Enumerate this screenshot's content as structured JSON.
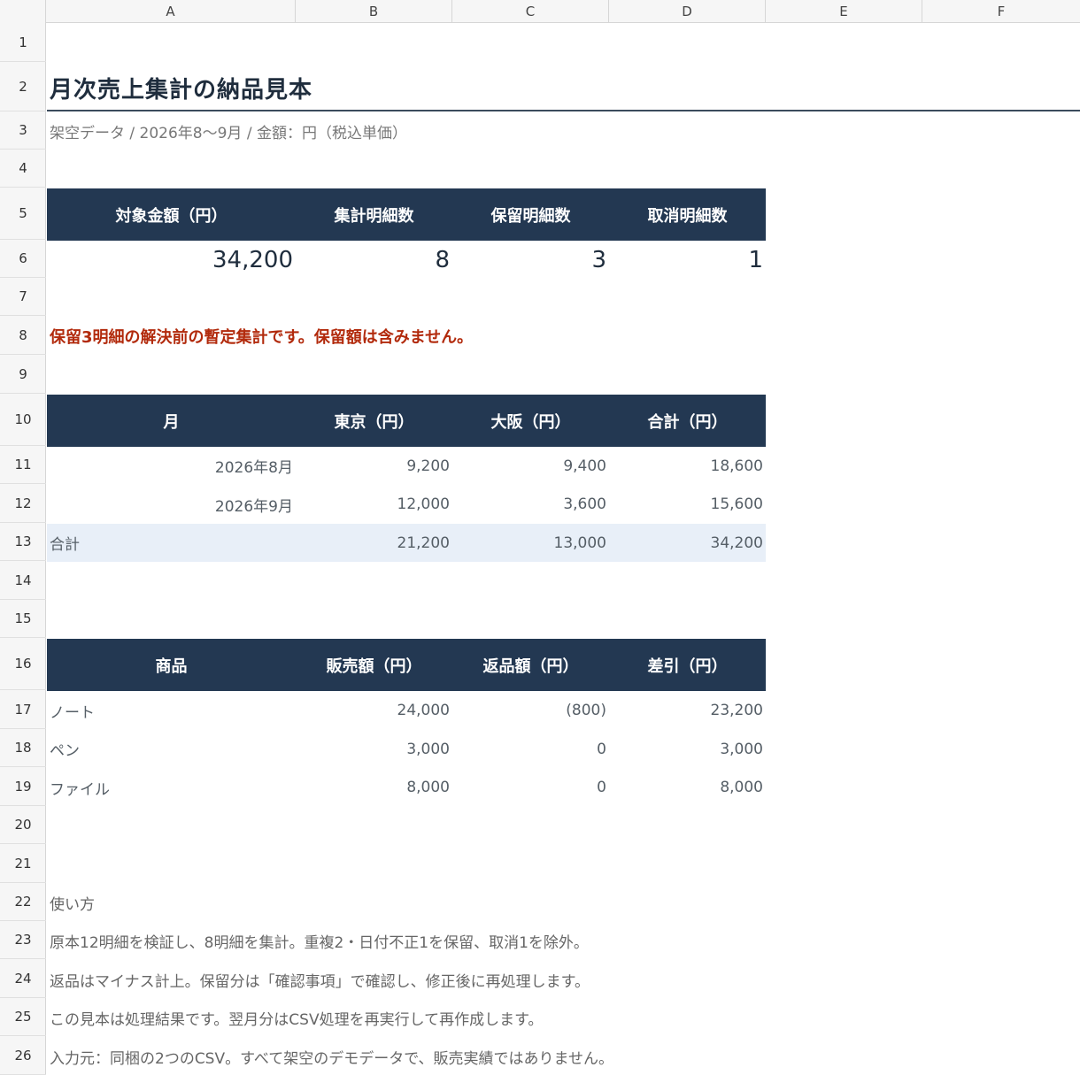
{
  "columns": [
    "A",
    "B",
    "C",
    "D",
    "E",
    "F"
  ],
  "rows": [
    "1",
    "2",
    "3",
    "4",
    "5",
    "6",
    "7",
    "8",
    "9",
    "10",
    "11",
    "12",
    "13",
    "14",
    "15",
    "16",
    "17",
    "18",
    "19",
    "20",
    "21",
    "22",
    "23",
    "24",
    "25",
    "26"
  ],
  "title": "月次売上集計の納品見本",
  "subtitle": "架空データ / 2026年8〜9月 / 金額：円（税込単価）",
  "kpi": {
    "headers": [
      "対象金額（円）",
      "集計明細数",
      "保留明細数",
      "取消明細数"
    ],
    "values": [
      "34,200",
      "8",
      "3",
      "1"
    ]
  },
  "warning": "保留3明細の解決前の暫定集計です。保留額は含みません。",
  "monthly": {
    "headers": [
      "月",
      "東京（円）",
      "大阪（円）",
      "合計（円）"
    ],
    "rows": [
      [
        "2026年8月",
        "9,200",
        "9,400",
        "18,600"
      ],
      [
        "2026年9月",
        "12,000",
        "3,600",
        "15,600"
      ]
    ],
    "total": [
      "合計",
      "21,200",
      "13,000",
      "34,200"
    ]
  },
  "products": {
    "headers": [
      "商品",
      "販売額（円）",
      "返品額（円）",
      "差引（円）"
    ],
    "rows": [
      [
        "ノート",
        "24,000",
        "(800)",
        "23,200"
      ],
      [
        "ペン",
        "3,000",
        "0",
        "3,000"
      ],
      [
        "ファイル",
        "8,000",
        "0",
        "8,000"
      ]
    ]
  },
  "notes": [
    "使い方",
    "原本12明細を検証し、8明細を集計。重複2・日付不正1を保留、取消1を除外。",
    "返品はマイナス計上。保留分は「確認事項」で確認し、修正後に再処理します。",
    "この見本は処理結果です。翌月分はCSV処理を再実行して再作成します。",
    "入力元：同梱の2つのCSV。すべて架空のデモデータで、販売実績ではありません。"
  ]
}
